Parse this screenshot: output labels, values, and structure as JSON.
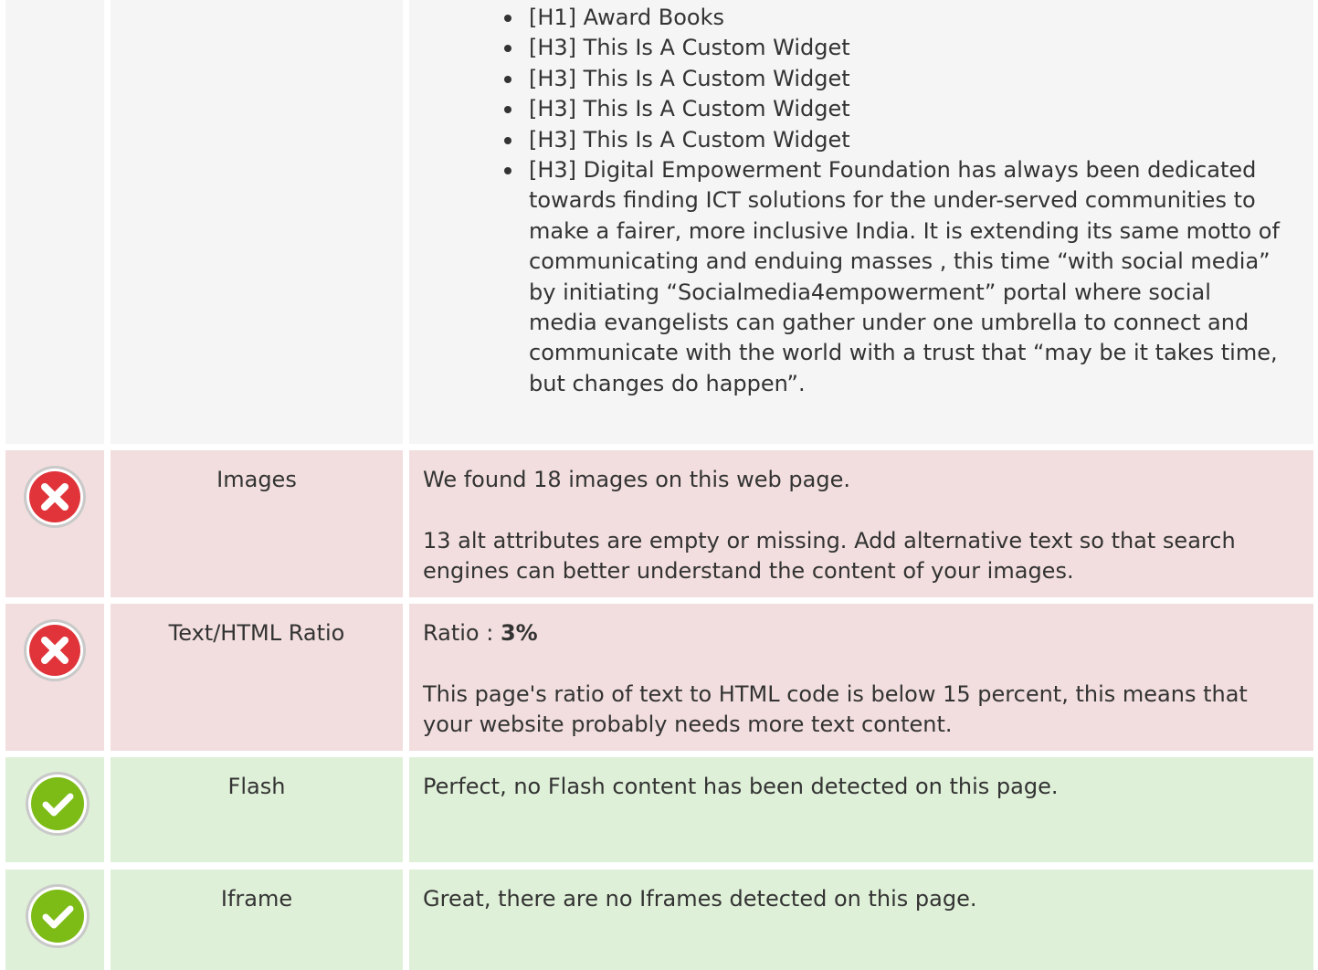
{
  "headings": {
    "items": [
      "[H1] Award Books",
      "[H3] This Is A Custom Widget",
      "[H3] This Is A Custom Widget",
      "[H3] This Is A Custom Widget",
      "[H3] This Is A Custom Widget",
      "[H3] Digital Empowerment Foundation has always been dedicated towards finding ICT solutions for the under-served communities to make a fairer, more inclusive India. It is extending its same motto of communicating and enduing masses , this time “with social media” by initiating “Socialmedia4empowerment” portal where social media evangelists can gather under one umbrella to connect and communicate with the world with a trust that “may be it takes time, but changes do happen”."
    ]
  },
  "checks": {
    "images": {
      "status": "error",
      "icon": "error-x-icon",
      "label": "Images",
      "line1": "We found 18 images on this web page.",
      "line2": "13 alt attributes are empty or missing. Add alternative text so that search engines can better understand the content of your images."
    },
    "ratio": {
      "status": "error",
      "icon": "error-x-icon",
      "label": "Text/HTML Ratio",
      "line1_prefix": "Ratio : ",
      "line1_value": "3%",
      "line2": "This page's ratio of text to HTML code is below 15 percent, this means that your website probably needs more text content."
    },
    "flash": {
      "status": "pass",
      "icon": "check-icon",
      "label": "Flash",
      "line1": "Perfect, no Flash content has been detected on this page."
    },
    "iframe": {
      "status": "pass",
      "icon": "check-icon",
      "label": "Iframe",
      "line1": "Great, there are no Iframes detected on this page."
    }
  },
  "colors": {
    "error_bg": "#f2dede",
    "pass_bg": "#dff0d8",
    "plain_bg": "#f5f5f5",
    "error_icon": "#e0343a",
    "pass_icon": "#7dbb16"
  }
}
